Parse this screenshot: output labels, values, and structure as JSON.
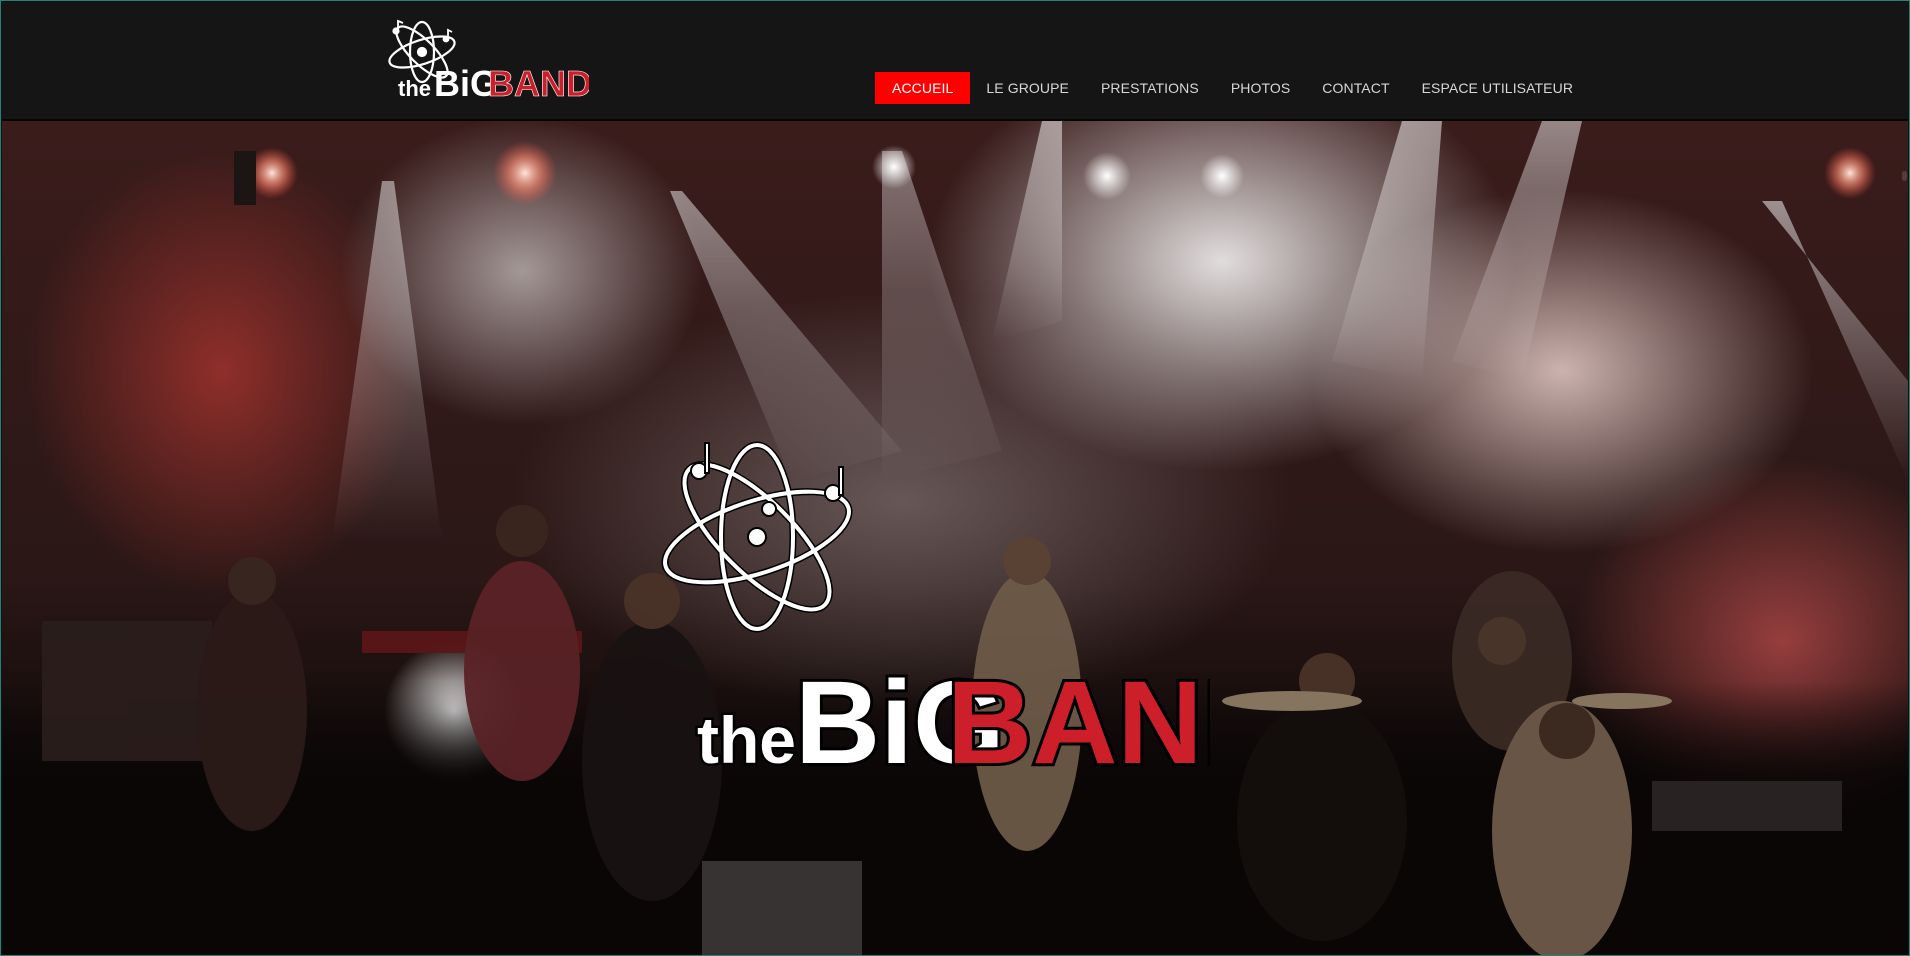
{
  "brand": {
    "logo_small_the": "the",
    "logo_small_big": "BiG",
    "logo_small_band": "BAND",
    "logo_hero_the": "the",
    "logo_hero_big": "BiG",
    "logo_hero_band": "BAND",
    "accent": "#ff0000",
    "logo_red": "#cc1f2a"
  },
  "nav": {
    "items": [
      {
        "label": "ACCUEIL",
        "active": true
      },
      {
        "label": "LE GROUPE",
        "active": false
      },
      {
        "label": "PRESTATIONS",
        "active": false
      },
      {
        "label": "PHOTOS",
        "active": false
      },
      {
        "label": "CONTACT",
        "active": false
      },
      {
        "label": "ESPACE UTILISATEUR",
        "active": false
      }
    ]
  },
  "hero": {
    "image": "concert-stage-photo",
    "icon": "atom-music-notes-icon"
  }
}
